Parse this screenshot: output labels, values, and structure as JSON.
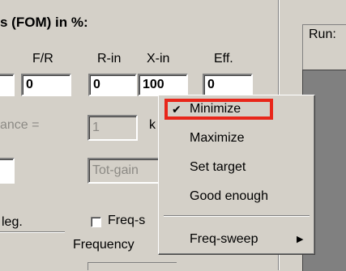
{
  "fom_header": "s (FOM) in %:",
  "columns": [
    "F/R",
    "R-in",
    "X-in",
    "Eff."
  ],
  "values": [
    "0",
    "0",
    "100",
    "0"
  ],
  "distance_label": "ance =",
  "distance_value": "1",
  "k_label": "k",
  "totgain_placeholder": "Tot-gain",
  "leg_label": "leg.",
  "freq_check_label": "Freq-s",
  "frequency_label": "Frequency",
  "run_label": "Run:",
  "menu": {
    "items": [
      "Minimize",
      "Maximize",
      "Set target",
      "Good enough"
    ],
    "checked": "Minimize",
    "submenu": "Freq-sweep",
    "checkmark": "✔",
    "arrow": "▶"
  },
  "colors": {
    "highlight_border": "#e8261a",
    "dark_panel": "#808080"
  }
}
